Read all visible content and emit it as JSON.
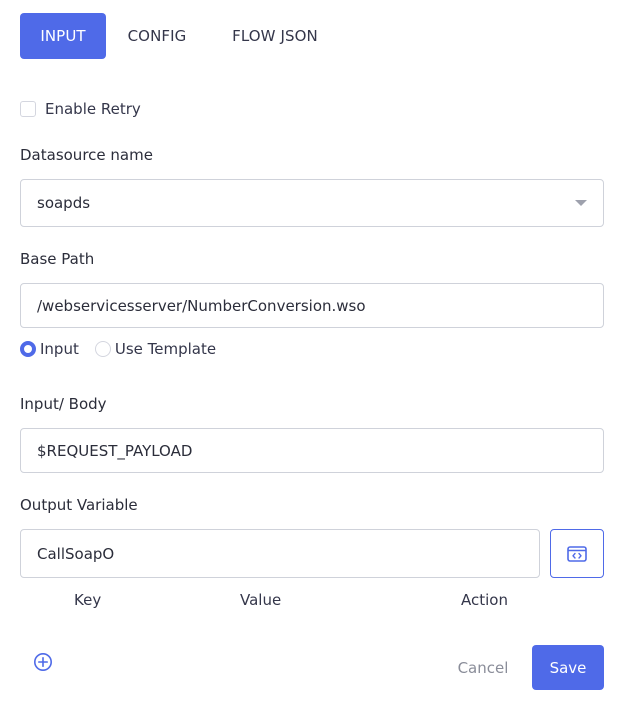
{
  "tabs": [
    {
      "label": "INPUT",
      "active": true
    },
    {
      "label": "CONFIG",
      "active": false
    },
    {
      "label": "FLOW JSON",
      "active": false
    }
  ],
  "retry": {
    "label": "Enable Retry",
    "checked": false
  },
  "datasource": {
    "label": "Datasource name",
    "value": "soapds"
  },
  "base_path": {
    "label": "Base Path",
    "value": "/webservicesserver/NumberConversion.wso"
  },
  "body_mode": {
    "options": [
      {
        "label": "Input",
        "selected": true
      },
      {
        "label": "Use Template",
        "selected": false
      }
    ]
  },
  "body": {
    "label": "Input/ Body",
    "value": "$REQUEST_PAYLOAD"
  },
  "output": {
    "label": "Output Variable",
    "value": "CallSoapO",
    "code_icon": "code-brackets-icon"
  },
  "table": {
    "headers": [
      "Key",
      "Value",
      "Action"
    ]
  },
  "footer": {
    "add_icon": "plus-circle-icon",
    "cancel_label": "Cancel",
    "save_label": "Save"
  },
  "colors": {
    "accent": "#4f6ae8",
    "border": "#cfd2da",
    "muted_text": "#8a8d99"
  }
}
